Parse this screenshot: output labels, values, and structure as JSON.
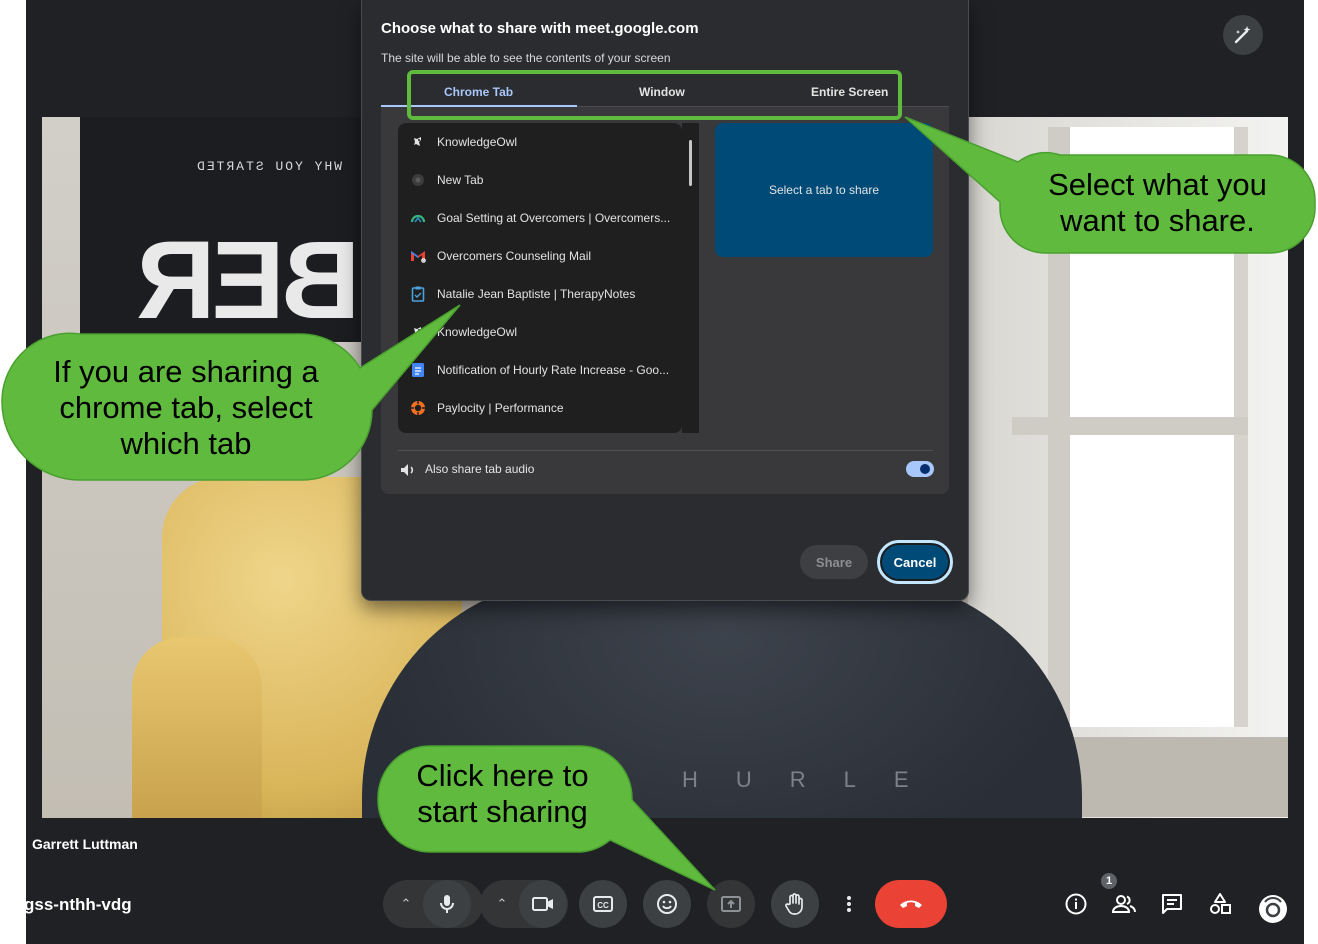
{
  "dialog": {
    "title": "Choose what to share with meet.google.com",
    "subtitle": "The site will be able to see the contents of your screen",
    "tabs": [
      {
        "label": "Chrome Tab",
        "selected": true
      },
      {
        "label": "Window",
        "selected": false
      },
      {
        "label": "Entire Screen",
        "selected": false
      }
    ],
    "tab_list": [
      {
        "title": "KnowledgeOwl",
        "icon": "knowledgeowl-icon"
      },
      {
        "title": "New Tab",
        "icon": "chrome-icon"
      },
      {
        "title": "Goal Setting at Overcomers | Overcomers...",
        "icon": "overcomers-icon"
      },
      {
        "title": "Overcomers Counseling Mail",
        "icon": "gmail-icon"
      },
      {
        "title": "Natalie Jean Baptiste | TherapyNotes",
        "icon": "therapynotes-icon"
      },
      {
        "title": "KnowledgeOwl",
        "icon": "knowledgeowl-icon"
      },
      {
        "title": "Notification of Hourly Rate Increase - Goo...",
        "icon": "google-docs-icon"
      },
      {
        "title": "Paylocity | Performance",
        "icon": "paylocity-icon"
      }
    ],
    "preview_text": "Select a tab to share",
    "audio_label": "Also share tab audio",
    "audio_enabled": true,
    "share_label": "Share",
    "cancel_label": "Cancel"
  },
  "meeting": {
    "participant_name": "Garrett Luttman",
    "meeting_code": "gss-nthh-vdg",
    "people_count": "1"
  },
  "video_scene": {
    "poster_text": "WHY YOU STARTED",
    "poster_big": "BER",
    "shirt_text": "HURLE"
  },
  "annotations": {
    "tabs_callout": "Select what you want to share.",
    "list_callout": "If you are sharing a chrome tab, select which tab",
    "share_callout": "Click here to start sharing"
  },
  "colors": {
    "callout_green": "#5fba3e",
    "accent_blue": "#a8c7fa",
    "end_call_red": "#ea4335"
  }
}
